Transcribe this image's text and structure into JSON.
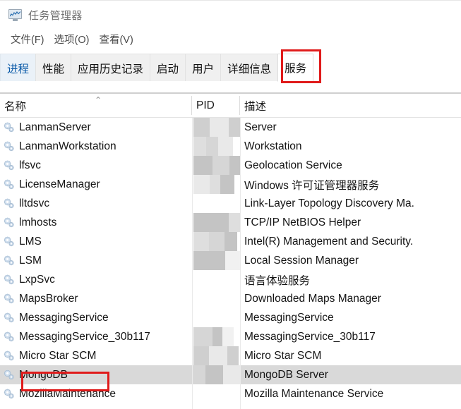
{
  "window": {
    "title": "任务管理器",
    "icon": "task-manager-icon"
  },
  "menubar": {
    "items": [
      {
        "label": "文件(F)"
      },
      {
        "label": "选项(O)"
      },
      {
        "label": "查看(V)"
      }
    ]
  },
  "tabs": {
    "active": "服务",
    "items": [
      {
        "label": "进程"
      },
      {
        "label": "性能"
      },
      {
        "label": "应用历史记录"
      },
      {
        "label": "启动"
      },
      {
        "label": "用户"
      },
      {
        "label": "详细信息"
      },
      {
        "label": "服务"
      }
    ]
  },
  "annotations": {
    "color": "#e01b1b",
    "boxes": [
      {
        "target": "tab-服务"
      },
      {
        "target": "row-MongoDB"
      }
    ]
  },
  "table": {
    "sort_column": "名称",
    "sort_direction": "ascending",
    "sort_caret": "⌃",
    "columns": [
      {
        "key": "name",
        "label": "名称"
      },
      {
        "key": "pid",
        "label": "PID"
      },
      {
        "key": "description",
        "label": "描述"
      }
    ],
    "rows": [
      {
        "name": "LanmanServer",
        "pid": "",
        "pid_redacted": true,
        "description": "Server",
        "selected": false
      },
      {
        "name": "LanmanWorkstation",
        "pid": "",
        "pid_redacted": true,
        "description": "Workstation",
        "selected": false
      },
      {
        "name": "lfsvc",
        "pid": "",
        "pid_redacted": true,
        "description": "Geolocation Service",
        "selected": false
      },
      {
        "name": "LicenseManager",
        "pid": "",
        "pid_redacted": true,
        "description": "Windows 许可证管理器服务",
        "selected": false
      },
      {
        "name": "lltdsvc",
        "pid": "",
        "pid_redacted": false,
        "description": "Link-Layer Topology Discovery Ma.",
        "selected": false
      },
      {
        "name": "lmhosts",
        "pid": "",
        "pid_redacted": true,
        "description": "TCP/IP NetBIOS Helper",
        "selected": false
      },
      {
        "name": "LMS",
        "pid": "",
        "pid_redacted": true,
        "description": "Intel(R) Management and Security.",
        "selected": false
      },
      {
        "name": "LSM",
        "pid": "",
        "pid_redacted": true,
        "description": "Local Session Manager",
        "selected": false
      },
      {
        "name": "LxpSvc",
        "pid": "",
        "pid_redacted": false,
        "description": "语言体验服务",
        "selected": false
      },
      {
        "name": "MapsBroker",
        "pid": "",
        "pid_redacted": false,
        "description": "Downloaded Maps Manager",
        "selected": false
      },
      {
        "name": "MessagingService",
        "pid": "",
        "pid_redacted": false,
        "description": "MessagingService",
        "selected": false
      },
      {
        "name": "MessagingService_30b117",
        "pid": "",
        "pid_redacted": true,
        "description": "MessagingService_30b117",
        "selected": false
      },
      {
        "name": "Micro Star SCM",
        "pid": "",
        "pid_redacted": true,
        "description": "Micro Star SCM",
        "selected": false
      },
      {
        "name": "MongoDB",
        "pid": "",
        "pid_redacted": true,
        "description": "MongoDB Server",
        "selected": true
      },
      {
        "name": "MozillaMaintenance",
        "pid": "",
        "pid_redacted": false,
        "description": "Mozilla Maintenance Service",
        "selected": false
      }
    ]
  }
}
